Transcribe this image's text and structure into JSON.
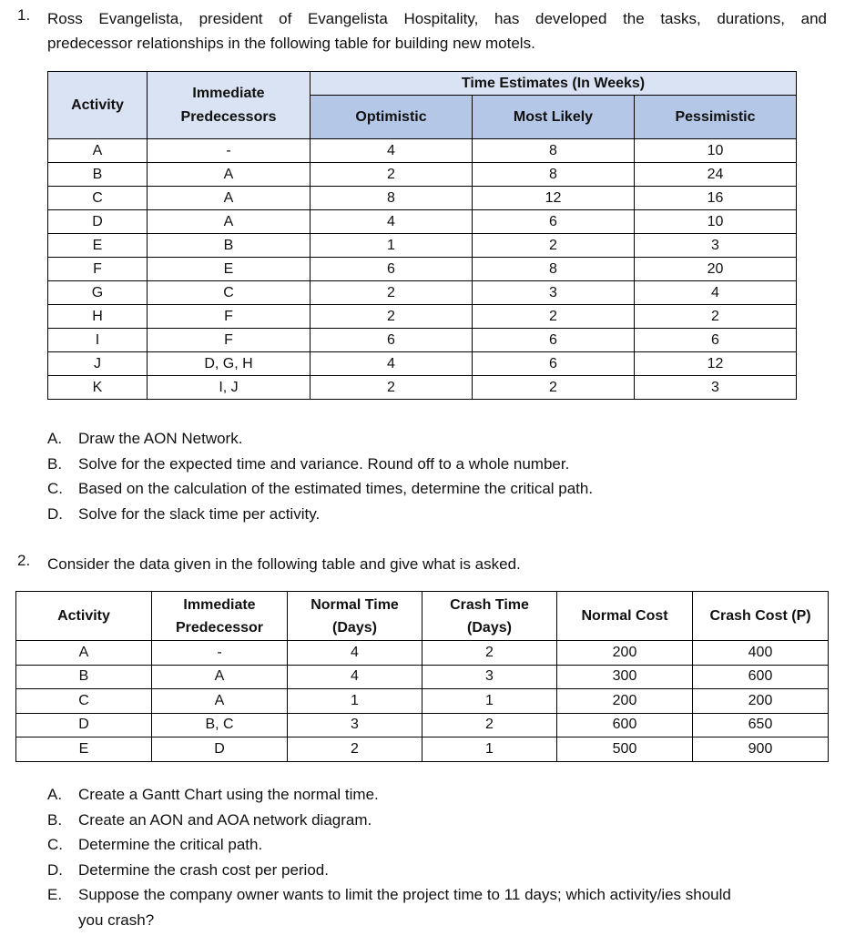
{
  "question1": {
    "number": "1.",
    "intro_line1": "Ross Evangelista, president of Evangelista Hospitality, has developed the tasks, durations, and",
    "intro_line2": "predecessor relationships in the following table for building new motels.",
    "table": {
      "headers": {
        "activity": "Activity",
        "predecessors": "Immediate Predecessors",
        "predecessors_line1": "Immediate",
        "predecessors_line2": "Predecessors",
        "group": "Time Estimates (In Weeks)",
        "optimistic": "Optimistic",
        "most_likely": "Most Likely",
        "pessimistic": "Pessimistic"
      },
      "rows": [
        {
          "activity": "A",
          "pred": "-",
          "opt": "4",
          "ml": "8",
          "pess": "10"
        },
        {
          "activity": "B",
          "pred": "A",
          "opt": "2",
          "ml": "8",
          "pess": "24"
        },
        {
          "activity": "C",
          "pred": "A",
          "opt": "8",
          "ml": "12",
          "pess": "16"
        },
        {
          "activity": "D",
          "pred": "A",
          "opt": "4",
          "ml": "6",
          "pess": "10"
        },
        {
          "activity": "E",
          "pred": "B",
          "opt": "1",
          "ml": "2",
          "pess": "3"
        },
        {
          "activity": "F",
          "pred": "E",
          "opt": "6",
          "ml": "8",
          "pess": "20"
        },
        {
          "activity": "G",
          "pred": "C",
          "opt": "2",
          "ml": "3",
          "pess": "4"
        },
        {
          "activity": "H",
          "pred": "F",
          "opt": "2",
          "ml": "2",
          "pess": "2"
        },
        {
          "activity": "I",
          "pred": "F",
          "opt": "6",
          "ml": "6",
          "pess": "6"
        },
        {
          "activity": "J",
          "pred": "D, G, H",
          "opt": "4",
          "ml": "6",
          "pess": "12"
        },
        {
          "activity": "K",
          "pred": "I, J",
          "opt": "2",
          "ml": "2",
          "pess": "3"
        }
      ]
    },
    "tasks": [
      {
        "letter": "A.",
        "text": "Draw the AON Network."
      },
      {
        "letter": "B.",
        "text": "Solve for the expected time and variance. Round off to a whole number."
      },
      {
        "letter": "C.",
        "text": "Based on the calculation of the estimated times, determine the critical path."
      },
      {
        "letter": "D.",
        "text": "Solve for the slack time per activity."
      }
    ]
  },
  "question2": {
    "number": "2.",
    "intro": "Consider the data given in the following table and give what is asked.",
    "table": {
      "headers": {
        "activity": "Activity",
        "pred_line1": "Immediate",
        "pred_line2": "Predecessor",
        "normal_time_line1": "Normal Time",
        "normal_time_line2": "(Days)",
        "crash_time_line1": "Crash Time",
        "crash_time_line2": "(Days)",
        "normal_cost": "Normal Cost",
        "crash_cost": "Crash Cost (P)"
      },
      "rows": [
        {
          "activity": "A",
          "pred": "-",
          "normal_time": "4",
          "crash_time": "2",
          "normal_cost": "200",
          "crash_cost": "400"
        },
        {
          "activity": "B",
          "pred": "A",
          "normal_time": "4",
          "crash_time": "3",
          "normal_cost": "300",
          "crash_cost": "600"
        },
        {
          "activity": "C",
          "pred": "A",
          "normal_time": "1",
          "crash_time": "1",
          "normal_cost": "200",
          "crash_cost": "200"
        },
        {
          "activity": "D",
          "pred": "B, C",
          "normal_time": "3",
          "crash_time": "2",
          "normal_cost": "600",
          "crash_cost": "650"
        },
        {
          "activity": "E",
          "pred": "D",
          "normal_time": "2",
          "crash_time": "1",
          "normal_cost": "500",
          "crash_cost": "900"
        }
      ]
    },
    "tasks": [
      {
        "letter": "A.",
        "text": "Create a Gantt Chart using the normal time."
      },
      {
        "letter": "B.",
        "text": "Create an AON and AOA network diagram."
      },
      {
        "letter": "C.",
        "text": "Determine the critical path."
      },
      {
        "letter": "D.",
        "text": "Determine the crash cost per period."
      },
      {
        "letter": "E.",
        "text": "Suppose the company owner wants to limit the project time to 11 days; which activity/ies should",
        "text_cont": "you crash?"
      }
    ]
  }
}
